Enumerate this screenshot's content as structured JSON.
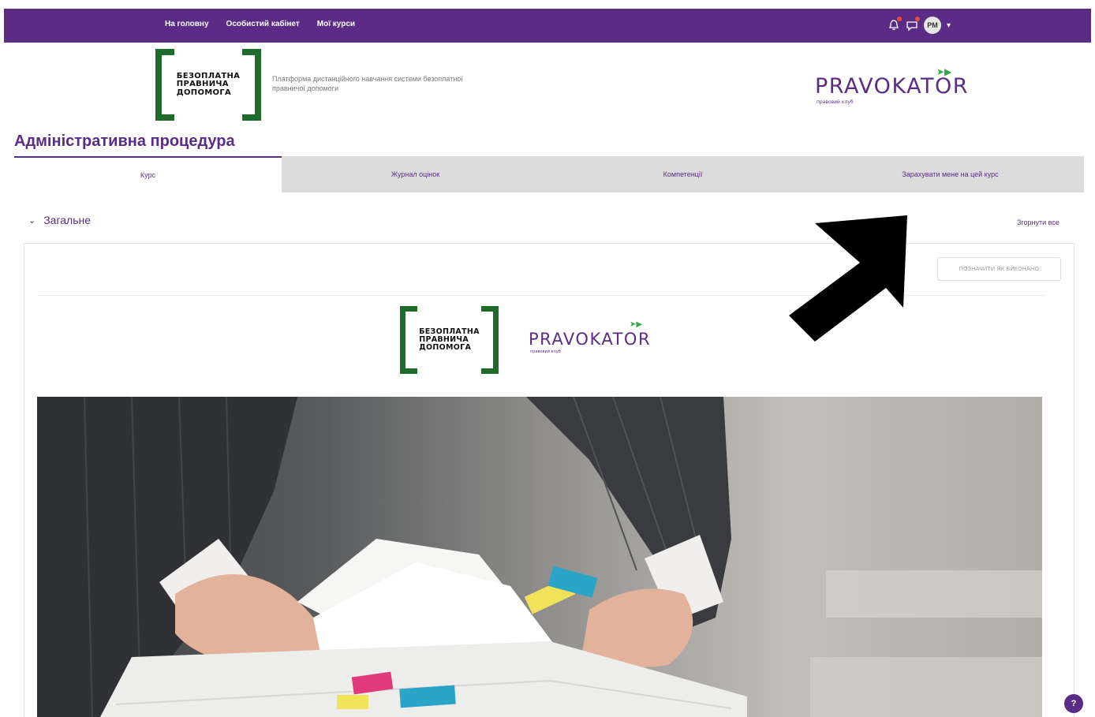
{
  "navbar": {
    "links": [
      "На головну",
      "Особистий кабінет",
      "Мої курси"
    ],
    "avatar_initials": "PM",
    "icons": [
      "bell-icon",
      "chat-icon"
    ]
  },
  "header": {
    "logo_lines": [
      "БЕЗОПЛАТНА",
      "ПРАВНИЧА",
      "ДОПОМОГА"
    ],
    "platform_text": "Платформа дистанційного навчання системи безоплатної правничої допомоги",
    "partner_logo": "PRAVOKATOR",
    "partner_arrows": "➤▶",
    "partner_sub": "правовий клуб"
  },
  "page": {
    "title": "Адміністративна процедура"
  },
  "tabs": [
    "Курс",
    "Журнал оцінок",
    "Компетенції",
    "Зарахувати мене на цей курс"
  ],
  "section": {
    "title": "Загальне",
    "collapse_all": "Згорнути все",
    "mark_done": "ПОЗНАЧИТИ ЯК ВИКОНАНО"
  },
  "help": "?",
  "colors": {
    "brand_purple": "#5a2c86",
    "brand_green": "#1f6b2b",
    "tab_inactive": "#dcdcdc"
  }
}
